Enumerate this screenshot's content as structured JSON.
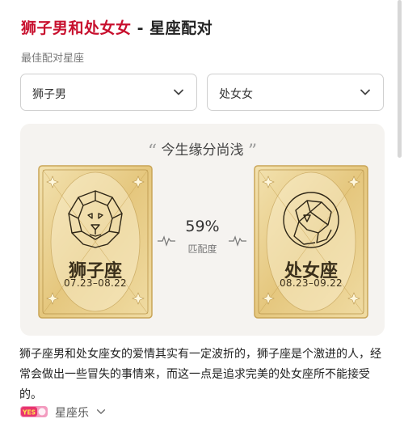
{
  "header": {
    "title_highlight": "狮子男和处女女",
    "title_rest": " - 星座配对",
    "subtitle": "最佳配对星座"
  },
  "selects": {
    "male_value": "狮子男",
    "female_value": "处女女"
  },
  "panel": {
    "quote": "今生缘分尚浅",
    "quote_open": "“",
    "quote_close": "”",
    "match_percent": "59%",
    "match_label": "匹配度"
  },
  "cards": {
    "left": {
      "name": "狮子座",
      "dates": "07.23–08.22",
      "icon": "lion-icon"
    },
    "right": {
      "name": "处女座",
      "dates": "08.23–09.22",
      "icon": "virgo-maiden-icon"
    }
  },
  "description": "狮子座男和处女座女的爱情其实有一定波折的，狮子座是个激进的人，经常会做出一些冒失的事情来，而这一点是追求完美的处女座所不能接受的。",
  "footer": {
    "source_name": "星座乐",
    "logo_text": "YES"
  },
  "colors": {
    "accent": "#c8102e",
    "card_gold": "#e9cf8c",
    "panel_bg": "#f5f3f0"
  }
}
